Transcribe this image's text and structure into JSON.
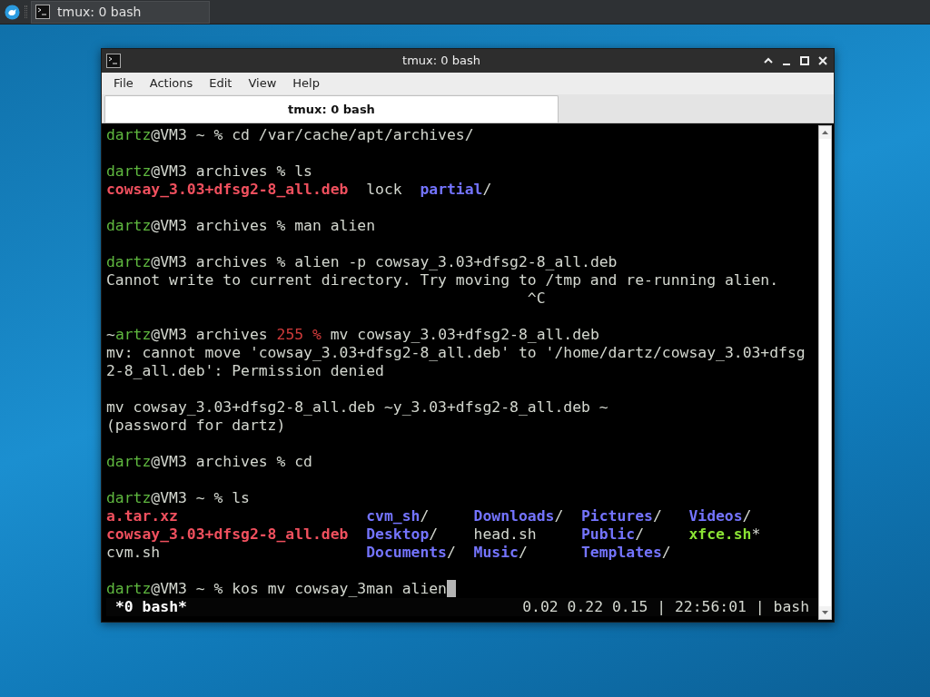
{
  "panel": {
    "task": {
      "title": "tmux: 0 bash",
      "selected": true
    }
  },
  "window": {
    "title": "tmux: 0 bash",
    "menu": [
      "File",
      "Actions",
      "Edit",
      "View",
      "Help"
    ],
    "tabs": [
      {
        "label": "tmux: 0 bash",
        "selected": true
      }
    ]
  },
  "terminal": {
    "lines": [
      {
        "kind": "text",
        "segments": [
          {
            "text": "dartz",
            "kind": "user"
          },
          {
            "text": "@VM3 ~ % cd /var/cache/apt/archives/",
            "kind": "plain"
          }
        ]
      },
      {
        "kind": "blank"
      },
      {
        "kind": "text",
        "segments": [
          {
            "text": "dartz",
            "kind": "user"
          },
          {
            "text": "@VM3 archives % ls",
            "kind": "plain"
          }
        ]
      },
      {
        "kind": "text",
        "segments": [
          {
            "text": "cowsay_3.03+dfsg2-8_all.deb",
            "kind": "archive"
          },
          {
            "text": "  lock  ",
            "kind": "plain"
          },
          {
            "text": "partial",
            "kind": "dir"
          },
          {
            "text": "/",
            "kind": "plain"
          }
        ]
      },
      {
        "kind": "blank"
      },
      {
        "kind": "text",
        "segments": [
          {
            "text": "dartz",
            "kind": "user"
          },
          {
            "text": "@VM3 archives % man alien",
            "kind": "plain"
          }
        ]
      },
      {
        "kind": "blank"
      },
      {
        "kind": "text",
        "segments": [
          {
            "text": "dartz",
            "kind": "user"
          },
          {
            "text": "@VM3 archives % alien -p cowsay_3.03+dfsg2-8_all.deb",
            "kind": "plain"
          }
        ]
      },
      {
        "kind": "text",
        "segments": [
          {
            "text": "Cannot write to current directory. Try moving to /tmp and re-running alien.",
            "kind": "plain"
          }
        ]
      },
      {
        "kind": "indented",
        "segments": [
          {
            "text": "^C",
            "kind": "plain"
          }
        ]
      },
      {
        "kind": "blank"
      },
      {
        "kind": "text",
        "segments": [
          {
            "text": "~",
            "kind": "plain"
          },
          {
            "text": "artz",
            "kind": "user"
          },
          {
            "text": "@VM3 archives ",
            "kind": "plain"
          },
          {
            "text": "255 %",
            "kind": "error"
          },
          {
            "text": " mv cowsay_3.03+dfsg2-8_all.deb",
            "kind": "plain"
          }
        ]
      },
      {
        "kind": "text",
        "segments": [
          {
            "text": "mv: cannot move 'cowsay_3.03+dfsg2-8_all.deb' to '/home/dartz/cowsay_3.03+dfsg",
            "kind": "plain"
          }
        ]
      },
      {
        "kind": "text",
        "segments": [
          {
            "text": "2-8_all.deb': Permission denied",
            "kind": "plain"
          }
        ]
      },
      {
        "kind": "blank"
      },
      {
        "kind": "text",
        "segments": [
          {
            "text": "mv cowsay_3.03+dfsg2-8_all.deb ~y_3.03+dfsg2-8_all.deb ~",
            "kind": "plain"
          }
        ]
      },
      {
        "kind": "text",
        "segments": [
          {
            "text": "(password for dartz)",
            "kind": "plain"
          }
        ]
      },
      {
        "kind": "blank"
      },
      {
        "kind": "text",
        "segments": [
          {
            "text": "dartz",
            "kind": "user"
          },
          {
            "text": "@VM3 archives % cd",
            "kind": "plain"
          }
        ]
      },
      {
        "kind": "blank"
      },
      {
        "kind": "text",
        "segments": [
          {
            "text": "dartz",
            "kind": "user"
          },
          {
            "text": "@VM3 ~ % ls",
            "kind": "plain"
          }
        ]
      },
      {
        "kind": "columns",
        "cells": [
          [
            {
              "text": "a.tar.xz",
              "kind": "archive"
            }
          ],
          [
            {
              "text": "cvm_sh",
              "kind": "dir"
            },
            {
              "text": "/",
              "kind": "plain"
            }
          ],
          [
            {
              "text": "Downloads",
              "kind": "dir"
            },
            {
              "text": "/",
              "kind": "plain"
            }
          ],
          [
            {
              "text": "Pictures",
              "kind": "dir"
            },
            {
              "text": "/",
              "kind": "plain"
            }
          ],
          [
            {
              "text": "Videos",
              "kind": "dir"
            },
            {
              "text": "/",
              "kind": "plain"
            }
          ]
        ]
      },
      {
        "kind": "columns",
        "cells": [
          [
            {
              "text": "cowsay_3.03+dfsg2-8_all.deb",
              "kind": "archive"
            }
          ],
          [
            {
              "text": "Desktop",
              "kind": "dir"
            },
            {
              "text": "/",
              "kind": "plain"
            }
          ],
          [
            {
              "text": "head.sh",
              "kind": "plain"
            }
          ],
          [
            {
              "text": "Public",
              "kind": "dir"
            },
            {
              "text": "/",
              "kind": "plain"
            }
          ],
          [
            {
              "text": "xfce.sh",
              "kind": "exec"
            },
            {
              "text": "*",
              "kind": "plain"
            }
          ]
        ]
      },
      {
        "kind": "columns",
        "cells": [
          [
            {
              "text": "cvm.sh",
              "kind": "plain"
            }
          ],
          [
            {
              "text": "Documents",
              "kind": "dir"
            },
            {
              "text": "/",
              "kind": "plain"
            }
          ],
          [
            {
              "text": "Music",
              "kind": "dir"
            },
            {
              "text": "/",
              "kind": "plain"
            }
          ],
          [
            {
              "text": "Templates",
              "kind": "dir"
            },
            {
              "text": "/",
              "kind": "plain"
            }
          ]
        ]
      },
      {
        "kind": "blank"
      },
      {
        "kind": "text",
        "cursor": true,
        "segments": [
          {
            "text": "dartz",
            "kind": "user"
          },
          {
            "text": "@VM3 ~ % kos mv cowsay_3man alien",
            "kind": "plain"
          }
        ]
      }
    ],
    "status_bar": {
      "window": "*0 bash*",
      "info": "0.02 0.22 0.15 | 22:56:01 | bash"
    }
  }
}
